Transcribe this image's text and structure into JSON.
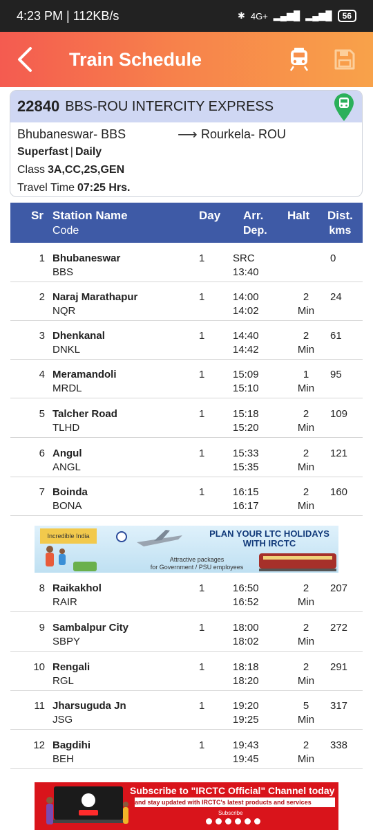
{
  "status_bar": {
    "time_speed": "4:23 PM | 112KB/s",
    "network": "4G+",
    "battery": "56"
  },
  "header": {
    "title": "Train Schedule"
  },
  "train": {
    "number": "22840",
    "name": "BBS-ROU INTERCITY EXPRESS",
    "from": "Bhubaneswar- BBS",
    "to": "Rourkela- ROU",
    "type": "Superfast",
    "sep": "|",
    "frequency": "Daily",
    "class_label": "Class",
    "classes": "3A,CC,2S,GEN",
    "travel_label": "Travel Time",
    "travel_time": "07:25 Hrs."
  },
  "table": {
    "headers": {
      "sr": "Sr",
      "station": "Station Name",
      "code": "Code",
      "day": "Day",
      "arr": "Arr.",
      "dep": "Dep.",
      "halt": "Halt",
      "dist": "Dist.",
      "dist_unit": "kms"
    },
    "rows": [
      {
        "sr": "1",
        "name": "Bhubaneswar",
        "code": "BBS",
        "day": "1",
        "arr": "SRC",
        "dep": "13:40",
        "halt": "",
        "halt_unit": "",
        "dist": "0"
      },
      {
        "sr": "2",
        "name": "Naraj Marathapur",
        "code": "NQR",
        "day": "1",
        "arr": "14:00",
        "dep": "14:02",
        "halt": "2",
        "halt_unit": "Min",
        "dist": "24"
      },
      {
        "sr": "3",
        "name": "Dhenkanal",
        "code": "DNKL",
        "day": "1",
        "arr": "14:40",
        "dep": "14:42",
        "halt": "2",
        "halt_unit": "Min",
        "dist": "61"
      },
      {
        "sr": "4",
        "name": "Meramandoli",
        "code": "MRDL",
        "day": "1",
        "arr": "15:09",
        "dep": "15:10",
        "halt": "1",
        "halt_unit": "Min",
        "dist": "95"
      },
      {
        "sr": "5",
        "name": "Talcher Road",
        "code": "TLHD",
        "day": "1",
        "arr": "15:18",
        "dep": "15:20",
        "halt": "2",
        "halt_unit": "Min",
        "dist": "109"
      },
      {
        "sr": "6",
        "name": "Angul",
        "code": "ANGL",
        "day": "1",
        "arr": "15:33",
        "dep": "15:35",
        "halt": "2",
        "halt_unit": "Min",
        "dist": "121"
      },
      {
        "sr": "7",
        "name": "Boinda",
        "code": "BONA",
        "day": "1",
        "arr": "16:15",
        "dep": "16:17",
        "halt": "2",
        "halt_unit": "Min",
        "dist": "160"
      },
      {
        "sr": "8",
        "name": "Raikakhol",
        "code": "RAIR",
        "day": "1",
        "arr": "16:50",
        "dep": "16:52",
        "halt": "2",
        "halt_unit": "Min",
        "dist": "207"
      },
      {
        "sr": "9",
        "name": "Sambalpur City",
        "code": "SBPY",
        "day": "1",
        "arr": "18:00",
        "dep": "18:02",
        "halt": "2",
        "halt_unit": "Min",
        "dist": "272"
      },
      {
        "sr": "10",
        "name": "Rengali",
        "code": "RGL",
        "day": "1",
        "arr": "18:18",
        "dep": "18:20",
        "halt": "2",
        "halt_unit": "Min",
        "dist": "291"
      },
      {
        "sr": "11",
        "name": "Jharsuguda Jn",
        "code": "JSG",
        "day": "1",
        "arr": "19:20",
        "dep": "19:25",
        "halt": "5",
        "halt_unit": "Min",
        "dist": "317"
      },
      {
        "sr": "12",
        "name": "Bagdihi",
        "code": "BEH",
        "day": "1",
        "arr": "19:43",
        "dep": "19:45",
        "halt": "2",
        "halt_unit": "Min",
        "dist": "338"
      }
    ]
  },
  "ads": {
    "ltc": {
      "logo_text": "Incredible India",
      "headline": "PLAN YOUR LTC HOLIDAYS",
      "headline2": "WITH IRCTC",
      "line1": "Attractive packages",
      "line2": "for Government / PSU employees"
    },
    "youtube": {
      "headline": "Subscribe to \"IRCTC Official\" Channel today",
      "subline": "and stay updated with IRCTC's latest products and services",
      "small": "Subscribe"
    }
  },
  "colors": {
    "appbar_start": "#f45b50",
    "appbar_end": "#f8a24a",
    "table_header": "#3e5aa6",
    "card_header": "#cfd7f3",
    "pin_green": "#2bb05a"
  },
  "icons": {
    "back": "back-arrow-icon",
    "train": "train-icon",
    "save": "save-icon",
    "map_pin": "map-pin-train-icon"
  }
}
